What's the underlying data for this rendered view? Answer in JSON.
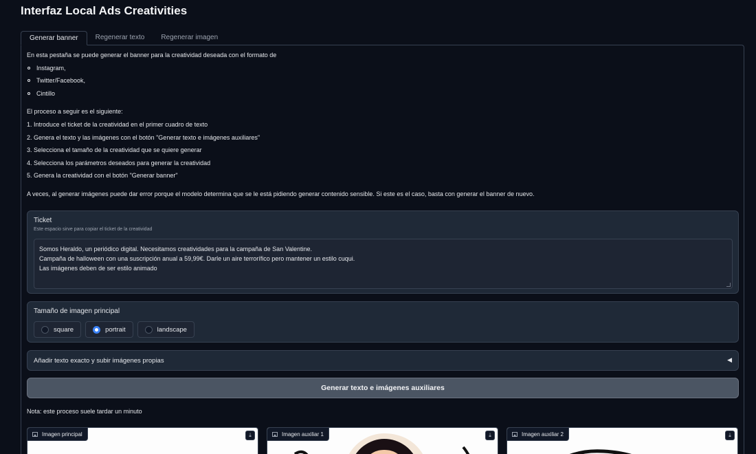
{
  "app": {
    "title": "Interfaz Local Ads Creativities"
  },
  "tabs": [
    {
      "label": "Generar banner",
      "active": true
    },
    {
      "label": "Regenerar texto",
      "active": false
    },
    {
      "label": "Regenerar imagen",
      "active": false
    }
  ],
  "intro": {
    "line1": "En esta pestaña se puede generar el banner para la creatividad deseada con el formato de",
    "formats": [
      "Instagram,",
      "Twitter/Facebook,",
      "Cintillo"
    ],
    "process_title": "El proceso a seguir es el siguiente:",
    "steps": [
      "1. Introduce el ticket de la creatividad en el primer cuadro de texto",
      "2. Genera el texto y las imágenes con el botón \"Generar texto e imágenes auxiliares\"",
      "3. Selecciona el tamaño de la creatividad que se quiere generar",
      "4. Selecciona los parámetros deseados para generar la creatividad",
      "5. Genera la creatividad con el botón \"Generar banner\""
    ],
    "warning": "A veces, al generar imágenes puede dar error porque el modelo determina que se le está pidiendo generar contenido sensible. Si este es el caso, basta con generar el banner de nuevo."
  },
  "ticket": {
    "label": "Ticket",
    "info": "Este espacio sirve para copiar el ticket de la creatividad",
    "lines": [
      "Somos Heraldo, un periódico digital. Necesitamos creatividades para la campaña de San Valentine.",
      "Campaña de halloween con una suscripción anual a 59,99€. Darle un aire terrorífico pero mantener un estilo cuqui.",
      "Las imágenes deben de ser estilo animado"
    ]
  },
  "image_size": {
    "label": "Tamaño de imagen principal",
    "options": [
      "square",
      "portrait",
      "landscape"
    ],
    "selected": "portrait"
  },
  "accordion": {
    "label": "Añadir texto exacto y subir imágenes propias",
    "arrow": "◀"
  },
  "generate_button": {
    "label": "Generar texto e imágenes auxiliares"
  },
  "note": "Nota: este proceso suele tardar un minuto",
  "images": [
    {
      "label": "Imagen principal"
    },
    {
      "label": "Imagen auxiliar 1"
    },
    {
      "label": "Imagen auxiliar 2"
    }
  ],
  "colors": {
    "background": "#0b0f19",
    "block": "#1f2937",
    "border": "#374151",
    "accent": "#3b82f6",
    "button": "#4b5563"
  }
}
